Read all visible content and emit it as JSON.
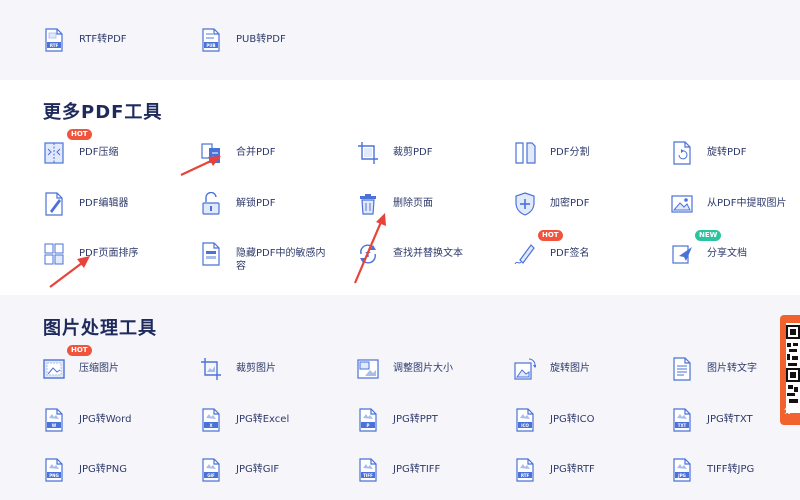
{
  "top_tools": [
    {
      "label": "RTF转PDF",
      "icon": "rtf-file-icon",
      "tag": "RTF"
    },
    {
      "label": "PUB转PDF",
      "icon": "pub-file-icon",
      "tag": "PUB"
    }
  ],
  "pdf_section": {
    "title": "更多PDF工具",
    "tools": [
      {
        "label": "PDF压缩",
        "icon": "compress-icon",
        "badge": "HOT"
      },
      {
        "label": "合并PDF",
        "icon": "merge-icon"
      },
      {
        "label": "裁剪PDF",
        "icon": "crop-icon"
      },
      {
        "label": "PDF分割",
        "icon": "split-icon"
      },
      {
        "label": "旋转PDF",
        "icon": "rotate-icon"
      },
      {
        "label": "PDF编辑器",
        "icon": "edit-icon"
      },
      {
        "label": "解锁PDF",
        "icon": "unlock-icon"
      },
      {
        "label": "删除页面",
        "icon": "trash-icon"
      },
      {
        "label": "加密PDF",
        "icon": "shield-icon"
      },
      {
        "label": "从PDF中提取图片",
        "icon": "extract-image-icon"
      },
      {
        "label": "PDF页面排序",
        "icon": "sort-pages-icon"
      },
      {
        "label": "隐藏PDF中的敏感内容",
        "icon": "redact-icon"
      },
      {
        "label": "查找并替换文本",
        "icon": "find-replace-icon"
      },
      {
        "label": "PDF签名",
        "icon": "signature-icon",
        "badge": "HOT"
      },
      {
        "label": "分享文档",
        "icon": "share-icon",
        "badge": "NEW"
      }
    ]
  },
  "image_section": {
    "title": "图片处理工具",
    "tools": [
      {
        "label": "压缩图片",
        "icon": "compress-image-icon",
        "badge": "HOT"
      },
      {
        "label": "裁剪图片",
        "icon": "crop-image-icon"
      },
      {
        "label": "调整图片大小",
        "icon": "resize-image-icon"
      },
      {
        "label": "旋转图片",
        "icon": "rotate-image-icon"
      },
      {
        "label": "图片转文字",
        "icon": "image-to-text-icon"
      },
      {
        "label": "JPG转Word",
        "icon": "jpg-word-icon",
        "tag": "W"
      },
      {
        "label": "JPG转Excel",
        "icon": "jpg-excel-icon",
        "tag": "X"
      },
      {
        "label": "JPG转PPT",
        "icon": "jpg-ppt-icon",
        "tag": "P"
      },
      {
        "label": "JPG转ICO",
        "icon": "jpg-ico-icon",
        "tag": "ICO"
      },
      {
        "label": "JPG转TXT",
        "icon": "jpg-txt-icon",
        "tag": "TXT"
      },
      {
        "label": "JPG转PNG",
        "icon": "jpg-png-icon",
        "tag": "PNG"
      },
      {
        "label": "JPG转GIF",
        "icon": "jpg-gif-icon",
        "tag": "GIF"
      },
      {
        "label": "JPG转TIFF",
        "icon": "jpg-tiff-icon",
        "tag": "TIFF"
      },
      {
        "label": "JPG转RTF",
        "icon": "jpg-rtf-icon",
        "tag": "RTF"
      },
      {
        "label": "TIFF转JPG",
        "icon": "tiff-jpg-icon",
        "tag": "JPG"
      }
    ]
  },
  "side_widget": {
    "text": "分",
    "icon": "qr-code-icon"
  },
  "colors": {
    "accent": "#4a72d8",
    "hot": "#f0543c",
    "new": "#2cc3a0",
    "arrow": "#e8433a"
  }
}
